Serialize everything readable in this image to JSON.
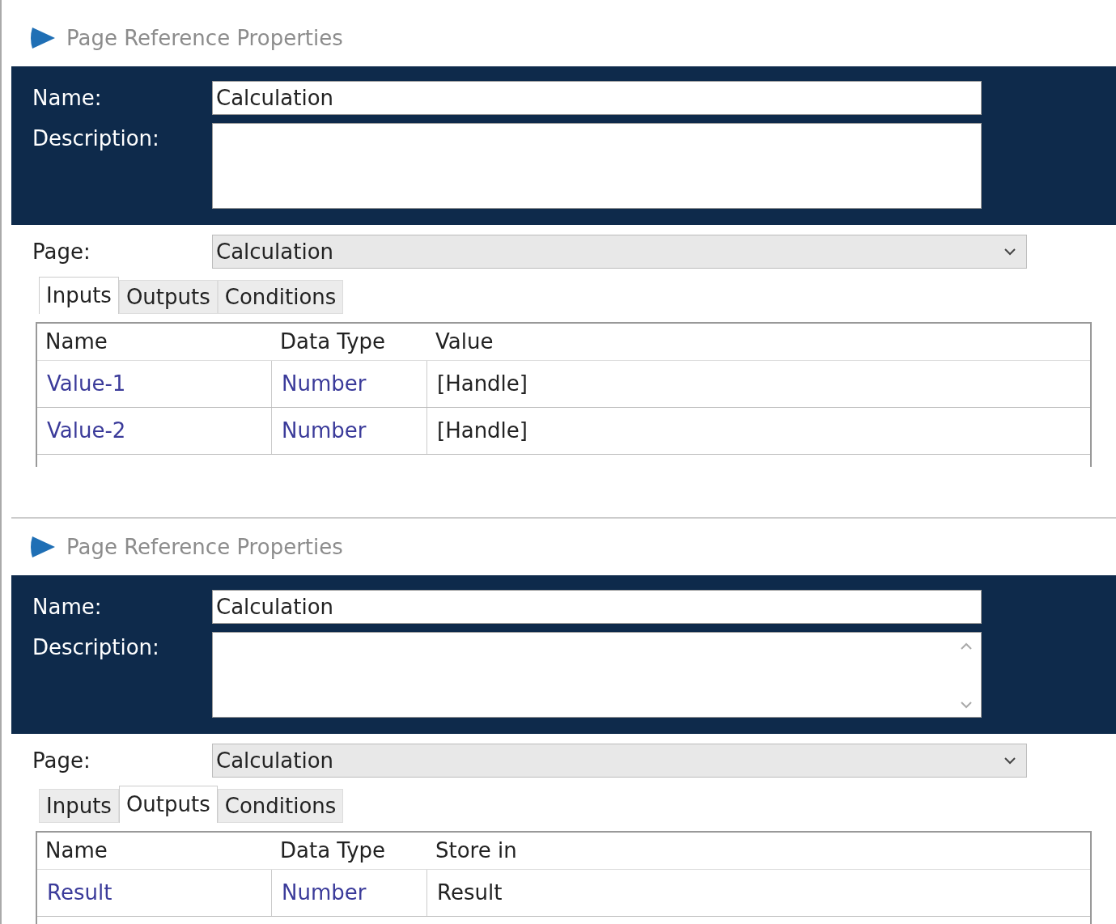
{
  "dialogs": [
    {
      "title": "Page Reference Properties",
      "name_label": "Name:",
      "name_value": "Calculation",
      "description_label": "Description:",
      "description_scrollbar": false,
      "page_label": "Page:",
      "page_value": "Calculation",
      "tabs": [
        {
          "label": "Inputs",
          "selected": true
        },
        {
          "label": "Outputs",
          "selected": false
        },
        {
          "label": "Conditions",
          "selected": false
        }
      ],
      "table": {
        "columns": [
          "Name",
          "Data Type",
          "Value"
        ],
        "rows": [
          [
            "Value-1",
            "Number",
            "[Handle]"
          ],
          [
            "Value-2",
            "Number",
            "[Handle]"
          ]
        ]
      }
    },
    {
      "title": "Page Reference Properties",
      "name_label": "Name:",
      "name_value": "Calculation",
      "description_label": "Description:",
      "description_scrollbar": true,
      "page_label": "Page:",
      "page_value": "Calculation",
      "tabs": [
        {
          "label": "Inputs",
          "selected": false
        },
        {
          "label": "Outputs",
          "selected": true
        },
        {
          "label": "Conditions",
          "selected": false
        }
      ],
      "table": {
        "columns": [
          "Name",
          "Data Type",
          "Store in"
        ],
        "rows": [
          [
            "Result",
            "Number",
            "Result"
          ]
        ]
      }
    }
  ]
}
